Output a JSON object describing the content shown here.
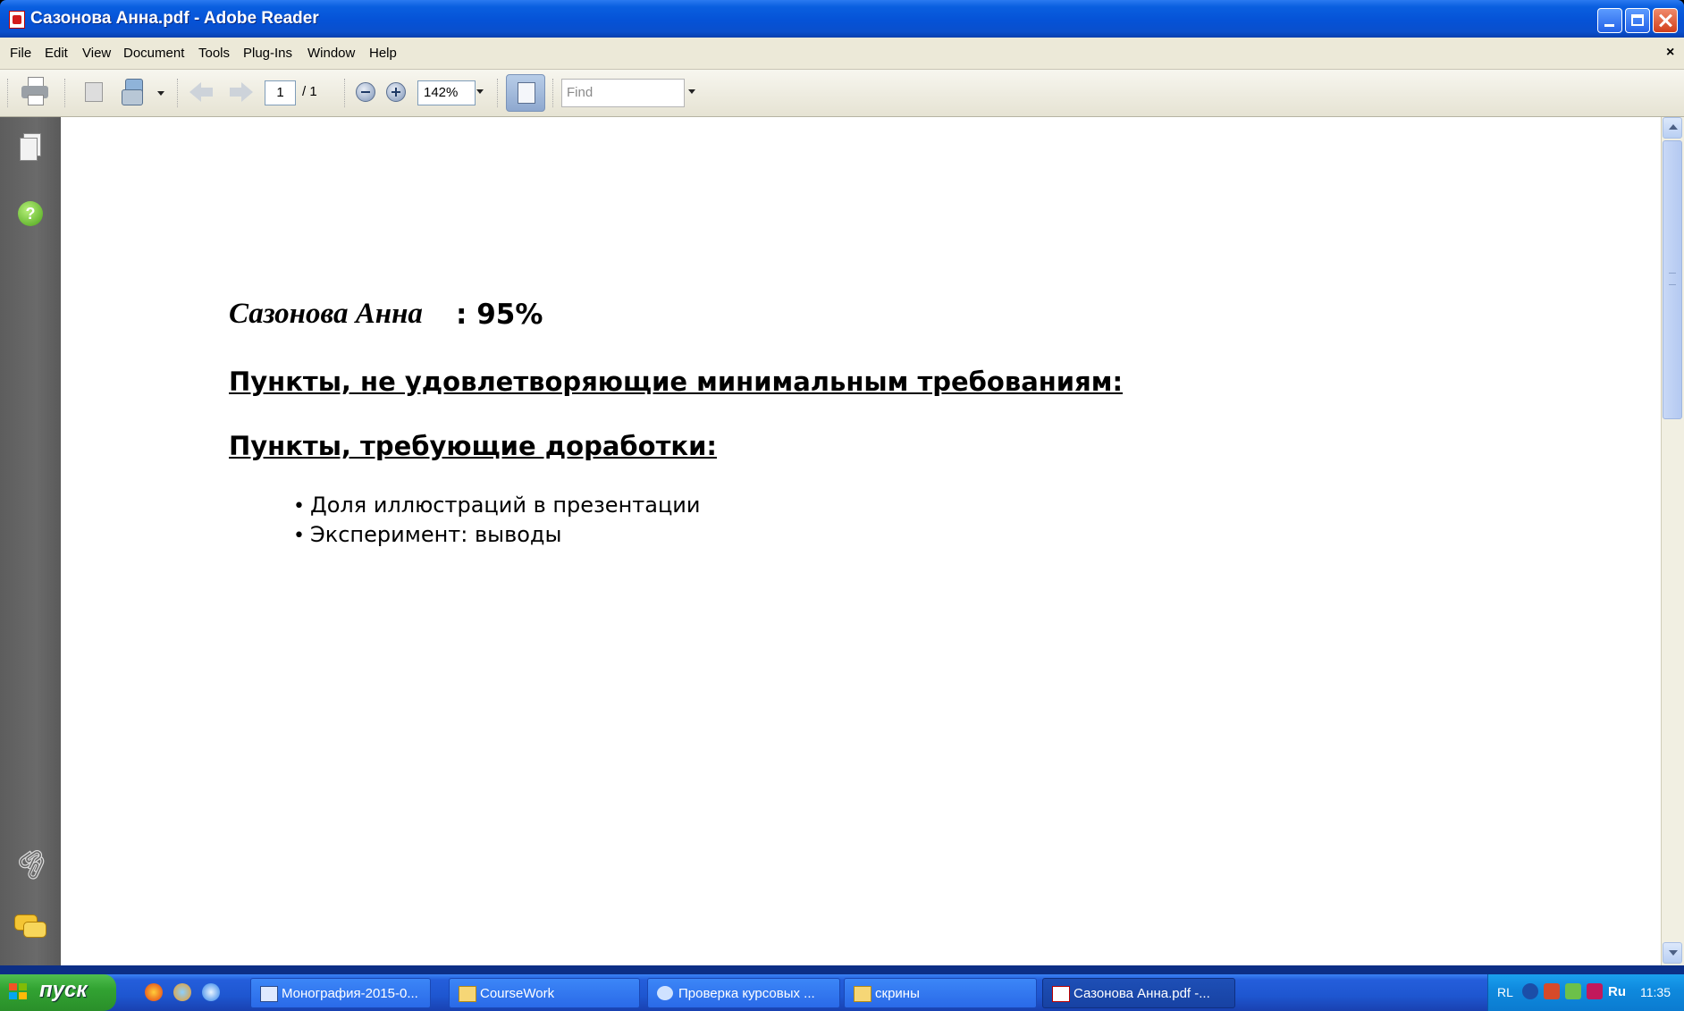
{
  "window": {
    "title": "Сазонова Анна.pdf - Adobe Reader"
  },
  "menubar": {
    "items": [
      "File",
      "Edit",
      "View",
      "Document",
      "Tools",
      "Plug-Ins",
      "Window",
      "Help"
    ],
    "close_doc": "×"
  },
  "toolbar": {
    "page_current": "1",
    "page_total": "/ 1",
    "zoom": "142%",
    "find_placeholder": "Find"
  },
  "document": {
    "author": "Сазонова Анна",
    "score": "95%",
    "heading_min": "Пункты, не удовлетворяющие минимальным требованиям:",
    "heading_improve": "Пункты, требующие доработки:",
    "items": [
      "Доля иллюстраций в презентации",
      "Эксперимент: выводы"
    ]
  },
  "taskbar": {
    "start_label": "пуск",
    "tasks": [
      {
        "label": "Монография-2015-0...",
        "icon": "document-icon",
        "active": false
      },
      {
        "label": "CourseWork",
        "icon": "folder-icon",
        "active": false
      },
      {
        "label": "Проверка курсовых ...",
        "icon": "browser-icon",
        "active": false
      },
      {
        "label": "скрины",
        "icon": "folder-icon",
        "active": false
      },
      {
        "label": "Сазонова Анна.pdf -...",
        "icon": "pdf-icon",
        "active": true
      }
    ],
    "tray": {
      "lang_left": "RL",
      "lang_right": "Ru",
      "clock": "11:35"
    }
  },
  "colors": {
    "titlebar": "#0552d6",
    "taskbar": "#245edb",
    "start": "#32a332",
    "nav_panel": "#616161"
  }
}
